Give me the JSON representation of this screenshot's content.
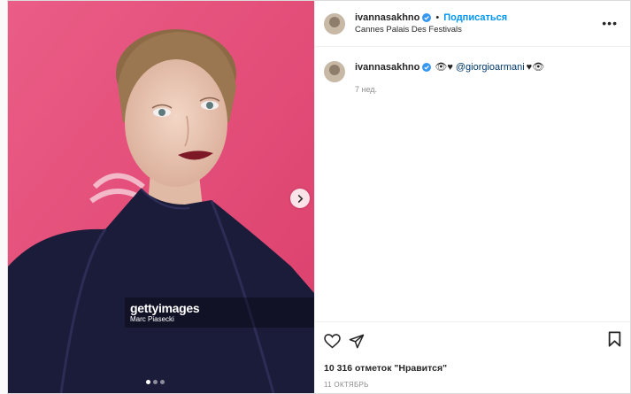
{
  "post": {
    "username": "ivannasakhno",
    "separator": "•",
    "follow_label": "Подписаться",
    "location": "Cannes Palais Des Festivals",
    "more_label": "•••",
    "caption_prefix": "👁♥",
    "caption_mention": "@giorgioarmani",
    "caption_suffix": "♥👁",
    "time_ago": "7 нед.",
    "likes": "10 316 отметок \"Нравится\"",
    "date": "11 ОКТЯБРЬ",
    "carousel": {
      "count": 3,
      "active": 1
    },
    "watermark": {
      "logo": "gettyimages",
      "credit": "Marc Piasecki"
    }
  },
  "colors": {
    "background": "#e74b78",
    "follow": "#0095f6",
    "verified": "#3897f0",
    "mention": "#00376b"
  },
  "icons": [
    "verified-icon",
    "next-icon",
    "heart-icon",
    "share-icon",
    "bookmark-icon",
    "more-icon"
  ]
}
